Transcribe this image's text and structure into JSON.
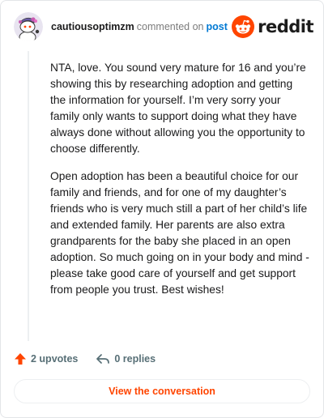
{
  "comment": {
    "username": "cautiousoptimzm",
    "action_text": "commented on",
    "post_link": "post",
    "paragraphs": [
      "NTA, love. You sound very mature for 16 and you’re showing this by researching adoption and getting the information for yourself. I’m very sorry your family only wants to support doing what they have always done without allowing you the opportunity to choose differently.",
      "Open adoption has been a beautiful choice for our family and friends, and for one of my daughter’s friends who is very much still a part of her child’s life and extended family. Her parents are also extra grandparents for the baby she placed in an open adoption. So much going on in your body and mind - please take good care of yourself and get support from people you trust. Best wishes!"
    ],
    "upvotes": "2 upvotes",
    "replies": "0 replies"
  },
  "brand": {
    "name": "reddit",
    "accent": "#ff4500"
  },
  "icons": {
    "avatar": "snoo-avatar-icon",
    "logo": "reddit-snoo-icon",
    "upvote": "upvote-arrow-icon",
    "reply": "reply-arrow-icon"
  },
  "cta": {
    "label": "View the conversation"
  }
}
